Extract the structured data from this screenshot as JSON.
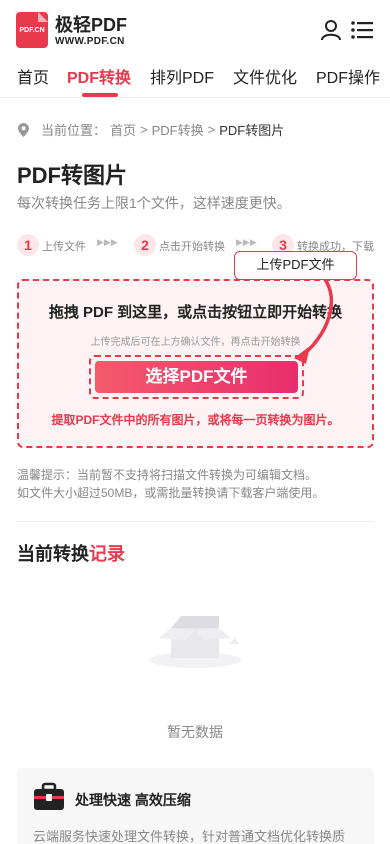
{
  "header": {
    "logo_text": "PDF.CN",
    "brand_name": "极轻PDF",
    "brand_url": "WWW.PDF.CN",
    "icons": [
      "user-icon",
      "menu-icon"
    ]
  },
  "nav": {
    "items": [
      "首页",
      "PDF转换",
      "排列PDF",
      "文件优化",
      "PDF操作"
    ],
    "active_index": 1
  },
  "breadcrumb": {
    "prefix": "当前位置：",
    "home": "首页",
    "sep1": ">",
    "section": "PDF转换",
    "sep2": ">",
    "current": "PDF转图片"
  },
  "page": {
    "title": "PDF转图片",
    "subtitle": "每次转换任务上限1个文件，这样速度更快。"
  },
  "steps": [
    {
      "num": "1",
      "label": "上传文件"
    },
    {
      "num": "2",
      "label": "点击开始转换"
    },
    {
      "num": "3",
      "label": "转换成功，下载"
    }
  ],
  "step_arrow": "▶▶▶",
  "upload": {
    "tooltip": "上传PDF文件",
    "drop_title": "拖拽 PDF 到这里，或点击按钮立即开始转换",
    "drop_hint": "上传完成后可在上方确认文件，再点击开始转换",
    "select_button": "选择PDF文件",
    "description": "提取PDF文件中的所有图片，或将每一页转换为图片。"
  },
  "tips": {
    "line1": "温馨提示：当前暂不支持将扫描文件转换为可编辑文档。",
    "line2": "如文件大小超过50MB，或需批量转换请下载客户端使用。"
  },
  "records": {
    "title_main": "当前转换",
    "title_highlight": "记录",
    "empty_text": "暂无数据"
  },
  "feature": {
    "title": "处理快速 高效压缩",
    "desc": "云端服务快速处理文件转换，针对普通文档优化转换质"
  },
  "colors": {
    "accent": "#e83a4c",
    "muted": "#888888"
  }
}
